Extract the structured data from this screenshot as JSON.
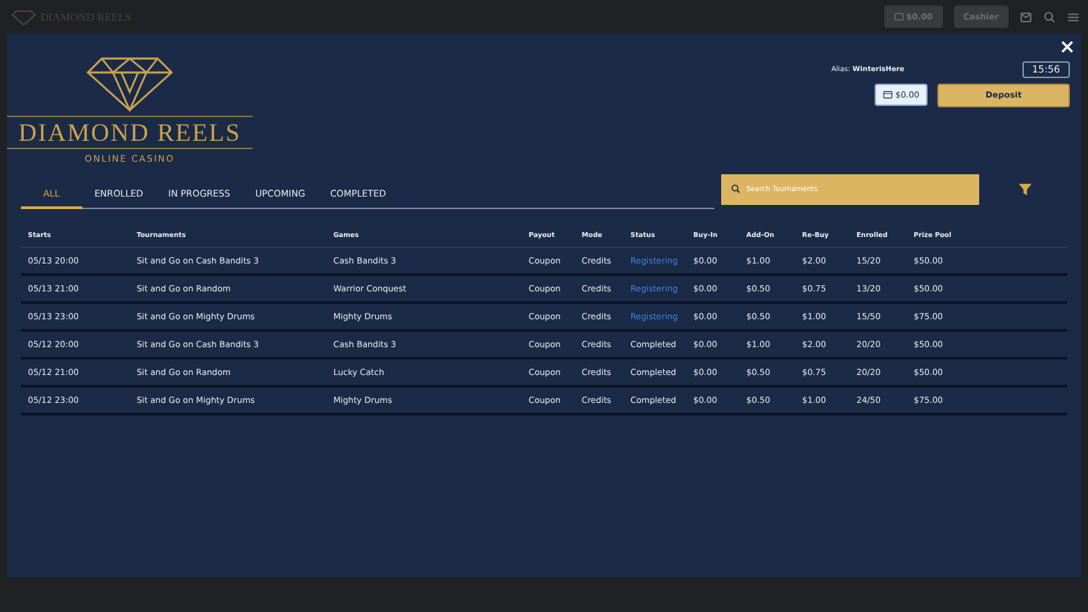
{
  "background_header": {
    "logo_text": "DIAMOND REELS",
    "balance": "$0.00",
    "cashier": "Cashier"
  },
  "modal": {
    "close": "×",
    "alias_label": "Alias:",
    "alias": "WinterisHere",
    "time": "15:56",
    "balance": "$0.00",
    "deposit": "Deposit",
    "logo": {
      "title": "DIAMOND REELS",
      "subtitle": "ONLINE CASINO"
    },
    "tabs": [
      {
        "label": "ALL",
        "selected": true
      },
      {
        "label": "ENROLLED",
        "selected": false
      },
      {
        "label": "IN PROGRESS",
        "selected": false
      },
      {
        "label": "UPCOMING",
        "selected": false
      },
      {
        "label": "COMPLETED",
        "selected": false
      }
    ],
    "search": {
      "placeholder": "Search Tournaments"
    },
    "table": {
      "columns": [
        "Starts",
        "Tournaments",
        "Games",
        "Payout",
        "Mode",
        "Status",
        "Buy-In",
        "Add-On",
        "Re-Buy",
        "Enrolled",
        "Prize Pool"
      ],
      "rows": [
        {
          "kind": "registering",
          "cells": [
            "05/13 20:00",
            "Sit and Go on Cash Bandits 3",
            "Cash Bandits 3",
            "Coupon",
            "Credits",
            "Registering",
            "$0.00",
            "$1.00",
            "$2.00",
            "15/20",
            "$50.00"
          ]
        },
        {
          "kind": "registering",
          "cells": [
            "05/13 21:00",
            "Sit and Go on Random",
            "Warrior Conquest",
            "Coupon",
            "Credits",
            "Registering",
            "$0.00",
            "$0.50",
            "$0.75",
            "13/20",
            "$50.00"
          ]
        },
        {
          "kind": "registering",
          "cells": [
            "05/13 23:00",
            "Sit and Go on Mighty Drums",
            "Mighty Drums",
            "Coupon",
            "Credits",
            "Registering",
            "$0.00",
            "$0.50",
            "$1.00",
            "15/50",
            "$75.00"
          ]
        },
        {
          "kind": "completed",
          "cells": [
            "05/12 20:00",
            "Sit and Go on Cash Bandits 3",
            "Cash Bandits 3",
            "Coupon",
            "Credits",
            "Completed",
            "$0.00",
            "$1.00",
            "$2.00",
            "20/20",
            "$50.00"
          ]
        },
        {
          "kind": "completed",
          "cells": [
            "05/12 21:00",
            "Sit and Go on Random",
            "Lucky Catch",
            "Coupon",
            "Credits",
            "Completed",
            "$0.00",
            "$0.50",
            "$0.75",
            "20/20",
            "$50.00"
          ]
        },
        {
          "kind": "completed",
          "cells": [
            "05/12 23:00",
            "Sit and Go on Mighty Drums",
            "Mighty Drums",
            "Coupon",
            "Credits",
            "Completed",
            "$0.00",
            "$0.50",
            "$1.00",
            "24/50",
            "$75.00"
          ]
        }
      ]
    }
  }
}
